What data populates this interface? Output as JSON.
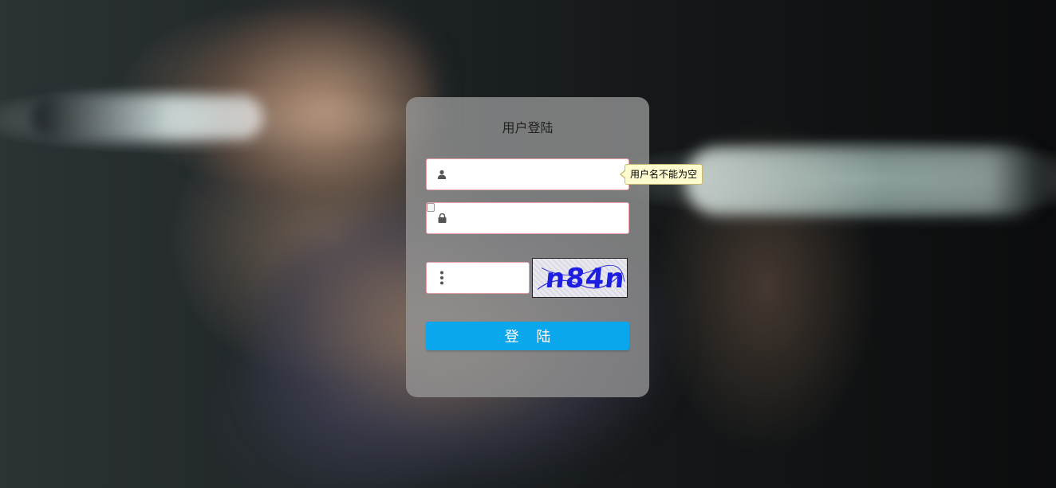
{
  "login": {
    "title": "用户登陆",
    "username": {
      "value": "",
      "icon": "user-icon",
      "validation_tooltip": "用户名不能为空"
    },
    "password": {
      "value": "",
      "icon": "lock-icon"
    },
    "captcha": {
      "value": "",
      "icon": "vertical-dots-icon",
      "image_text": "n84n"
    },
    "submit_label": "登 陆"
  },
  "colors": {
    "button": "#0ba7ec",
    "field_border": "#e8a0a8",
    "captcha_text": "#1e1ee0",
    "tooltip_bg": "#fffbd0"
  }
}
